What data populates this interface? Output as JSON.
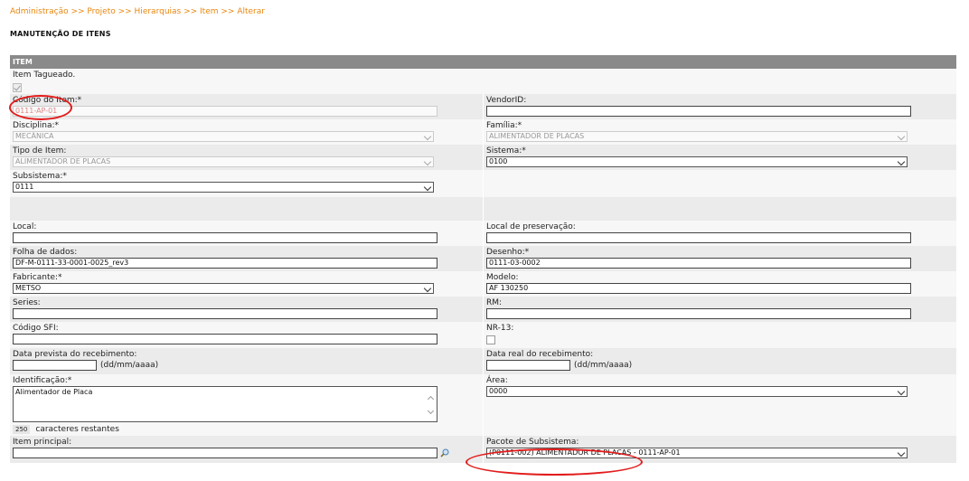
{
  "breadcrumb": "Administração >> Projeto >> Hierarquias >> Item >> Alterar",
  "page_title": "MANUTENÇÃO DE ITENS",
  "section_title": "ITEM",
  "fields": {
    "item_tagueado": {
      "label": "Item Tagueado.",
      "checked": true
    },
    "codigo_item": {
      "label": "Código do Item:*",
      "value": "0111-AP-01"
    },
    "vendor_id": {
      "label": "VendorID:",
      "value": ""
    },
    "disciplina": {
      "label": "Disciplina:*",
      "value": "MECÂNICA"
    },
    "familia": {
      "label": "Família:*",
      "value": "ALIMENTADOR DE PLACAS"
    },
    "tipo_item": {
      "label": "Tipo de Item:",
      "value": "ALIMENTADOR DE PLACAS"
    },
    "sistema": {
      "label": "Sistema:*",
      "value": "0100"
    },
    "subsistema": {
      "label": "Subsistema:*",
      "value": "0111"
    },
    "local": {
      "label": "Local:",
      "value": ""
    },
    "local_preservacao": {
      "label": "Local de preservação:",
      "value": ""
    },
    "folha_dados": {
      "label": "Folha de dados:",
      "value": "DF-M-0111-33-0001-0025_rev3"
    },
    "desenho": {
      "label": "Desenho:*",
      "value": "0111-03-0002"
    },
    "fabricante": {
      "label": "Fabricante:*",
      "value": "METSO"
    },
    "modelo": {
      "label": "Modelo:",
      "value": "AF 130250"
    },
    "series": {
      "label": "Series:",
      "value": ""
    },
    "rm": {
      "label": "RM:",
      "value": ""
    },
    "codigo_sfi": {
      "label": "Código SFI:",
      "value": ""
    },
    "nr13": {
      "label": "NR-13:",
      "checked": false
    },
    "data_prevista": {
      "label": "Data prevista do recebimento:",
      "value": "",
      "hint": "(dd/mm/aaaa)"
    },
    "data_real": {
      "label": "Data real do recebimento:",
      "value": "",
      "hint": "(dd/mm/aaaa)"
    },
    "identificacao": {
      "label": "Identificação:*",
      "value": "Alimentador de Placa",
      "remaining": "250",
      "remaining_text": "caracteres restantes"
    },
    "area": {
      "label": "Área:",
      "value": "0000"
    },
    "item_principal": {
      "label": "Item principal:",
      "value": ""
    },
    "pacote_subsistema": {
      "label": "Pacote de Subsistema:",
      "value": "(P0111-002) ALIMENTADOR DE PLACAS - 0111-AP-01"
    }
  },
  "icons": {
    "lookup": "magnifier-icon"
  },
  "colors": {
    "breadcrumb": "#e8870e",
    "section_header": "#8a8a8a",
    "annotation": "#e21c1c"
  }
}
